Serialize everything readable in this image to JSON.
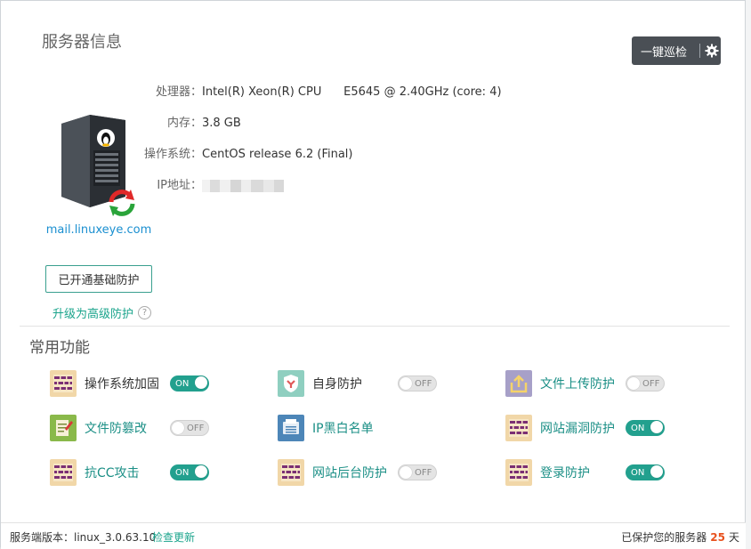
{
  "header": {
    "title": "服务器信息",
    "patrol_label": "一键巡检",
    "settings_icon": "gear-icon"
  },
  "server": {
    "hostname": "mail.linuxeye.com",
    "processor_label": "处理器：",
    "processor_value": "Intel(R) Xeon(R) CPU      E5645 @ 2.40GHz (core: 4)",
    "memory_label": "内存：",
    "memory_value": "3.8 GB",
    "os_label": "操作系统：",
    "os_value": "CentOS release 6.2 (Final)",
    "ip_label": "IP地址："
  },
  "protection": {
    "basic_label": "已开通基础防护",
    "upgrade_label": "升级为高级防护",
    "help_icon": "?"
  },
  "features_title": "常用功能",
  "features": [
    {
      "name": "操作系统加固",
      "state": "ON",
      "icon": "firewall-icon"
    },
    {
      "name": "自身防护",
      "state": "OFF",
      "icon": "self-shield-icon"
    },
    {
      "name": "文件上传防护",
      "state": "OFF",
      "icon": "upload-icon"
    },
    {
      "name": "文件防篡改",
      "state": "OFF",
      "icon": "file-edit-icon"
    },
    {
      "name": "IP黑白名单",
      "state": "",
      "icon": "printer-list-icon"
    },
    {
      "name": "网站漏洞防护",
      "state": "ON",
      "icon": "firewall-icon"
    },
    {
      "name": "抗CC攻击",
      "state": "ON",
      "icon": "firewall-icon"
    },
    {
      "name": "网站后台防护",
      "state": "OFF",
      "icon": "firewall-icon"
    },
    {
      "name": "登录防护",
      "state": "ON",
      "icon": "firewall-icon"
    }
  ],
  "footer": {
    "version_label": "服务端版本：linux_3.0.63.10",
    "check_update": "检查更新",
    "protected_prefix": "已保护您的服务器",
    "protected_days": "25",
    "protected_suffix": "天"
  },
  "colors": {
    "accent": "#22a08e",
    "link": "#1a8fd0",
    "highlight": "#e8521f",
    "dark_button": "#4a4f55"
  }
}
